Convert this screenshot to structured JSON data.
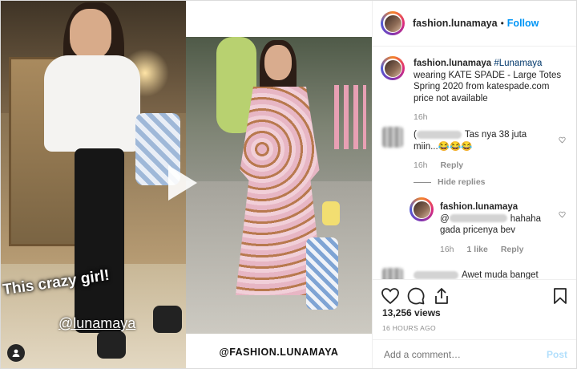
{
  "left_photo": {
    "caption_main": "This crazy girl!",
    "caption_mention": "@lunamaya",
    "user_icon": "user-tag-icon"
  },
  "middle_photo": {
    "watermark": "@FASHION.LUNAMAYA",
    "play_icon": "play-icon"
  },
  "header": {
    "username": "fashion.lunamaya",
    "separator": "•",
    "follow_label": "Follow"
  },
  "post": {
    "username": "fashion.lunamaya",
    "hashtag": "#Lunamaya",
    "caption": "wearing KATE SPADE - Large Totes Spring 2020 from katespade.com price not available",
    "age": "16h"
  },
  "comments": [
    {
      "text_prefix": "(",
      "text": "Tas nya 38 juta miin...😂😂😂",
      "age": "16h",
      "reply_label": "Reply",
      "hide_replies_label": "Hide replies"
    },
    {
      "username": "fashion.lunamaya",
      "text_prefix": "@",
      "text": "hahaha gada pricenya bev",
      "age": "16h",
      "likes": "1 like",
      "reply_label": "Reply"
    },
    {
      "text": "Awet muda banget"
    }
  ],
  "actions": {
    "like_icon": "heart-icon",
    "comment_icon": "comment-icon",
    "share_icon": "share-icon",
    "save_icon": "bookmark-icon",
    "views": "13,256 views",
    "time_ago": "16 HOURS AGO",
    "add_comment_placeholder": "Add a comment…",
    "post_label": "Post"
  }
}
